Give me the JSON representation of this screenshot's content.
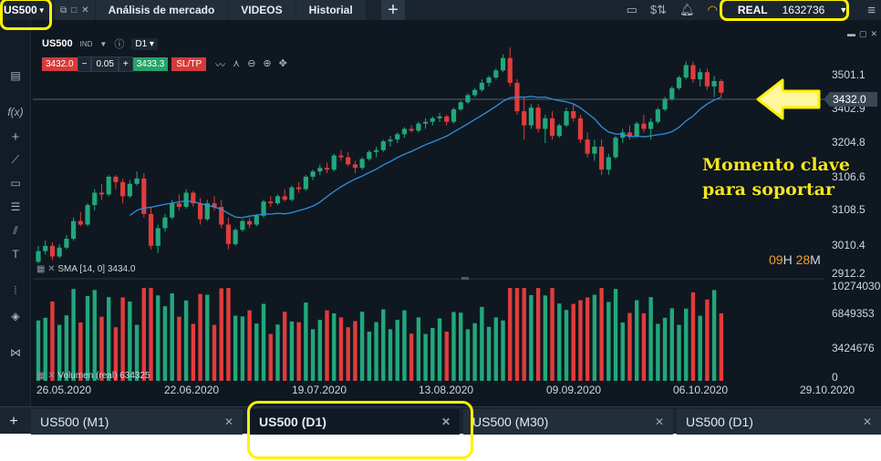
{
  "topbar": {
    "symbol": "US500",
    "tabs": [
      "Análisis de mercado",
      "VIDEOS",
      "Historial"
    ],
    "plus": "+",
    "account_type": "REAL",
    "balance": "1632736"
  },
  "chart": {
    "symbol": "US500",
    "symbol_tag": "IND",
    "timeframe": "D1",
    "sell_price": "3432.0",
    "spread": "0.05",
    "buy_price": "3433.3",
    "sltp_label": "SL/TP",
    "current_price_label": "3432.0",
    "countdown_h": "09",
    "countdown_m": "28",
    "sma_label": "SMA [14, 0] 3434.0",
    "volume_label": "Volumen (real) 634325"
  },
  "chart_data": {
    "type": "candlestick",
    "price_axis_ticks": [
      "3501.1",
      "3402.9",
      "3204.8",
      "3106.6",
      "3108.5",
      "3010.4",
      "2912.2"
    ],
    "volume_axis_ticks": [
      "10274030",
      "6849353",
      "3424676",
      "0"
    ],
    "date_ticks": [
      "26.05.2020",
      "22.06.2020",
      "19.07.2020",
      "13.08.2020",
      "09.09.2020",
      "06.10.2020",
      "29.10.2020"
    ],
    "ohlc": [
      [
        2955,
        3000,
        2950,
        2985
      ],
      [
        2985,
        3015,
        2975,
        3000
      ],
      [
        3000,
        3010,
        2960,
        2970
      ],
      [
        2970,
        3005,
        2965,
        2995
      ],
      [
        2995,
        3030,
        2990,
        3020
      ],
      [
        3020,
        3080,
        3015,
        3070
      ],
      [
        3070,
        3095,
        3055,
        3060
      ],
      [
        3060,
        3120,
        3055,
        3115
      ],
      [
        3115,
        3160,
        3100,
        3150
      ],
      [
        3150,
        3175,
        3130,
        3145
      ],
      [
        3145,
        3200,
        3140,
        3195
      ],
      [
        3195,
        3200,
        3160,
        3180
      ],
      [
        3180,
        3190,
        3120,
        3140
      ],
      [
        3140,
        3185,
        3135,
        3175
      ],
      [
        3175,
        3210,
        3170,
        3190
      ],
      [
        3190,
        3205,
        3080,
        3090
      ],
      [
        3090,
        3110,
        2990,
        3000
      ],
      [
        3000,
        3060,
        2980,
        3050
      ],
      [
        3050,
        3090,
        3040,
        3080
      ],
      [
        3080,
        3130,
        3075,
        3120
      ],
      [
        3120,
        3145,
        3100,
        3110
      ],
      [
        3110,
        3160,
        3105,
        3150
      ],
      [
        3150,
        3155,
        3110,
        3120
      ],
      [
        3120,
        3135,
        3060,
        3075
      ],
      [
        3075,
        3130,
        3070,
        3120
      ],
      [
        3120,
        3140,
        3100,
        3110
      ],
      [
        3110,
        3130,
        3050,
        3060
      ],
      [
        3060,
        3080,
        2990,
        3005
      ],
      [
        3005,
        3050,
        3000,
        3045
      ],
      [
        3045,
        3075,
        3040,
        3070
      ],
      [
        3070,
        3080,
        3050,
        3060
      ],
      [
        3060,
        3090,
        3055,
        3085
      ],
      [
        3085,
        3130,
        3080,
        3125
      ],
      [
        3125,
        3140,
        3110,
        3120
      ],
      [
        3120,
        3145,
        3115,
        3140
      ],
      [
        3140,
        3160,
        3125,
        3130
      ],
      [
        3130,
        3170,
        3125,
        3165
      ],
      [
        3165,
        3180,
        3150,
        3160
      ],
      [
        3160,
        3200,
        3155,
        3195
      ],
      [
        3195,
        3215,
        3185,
        3210
      ],
      [
        3210,
        3230,
        3200,
        3220
      ],
      [
        3220,
        3235,
        3205,
        3215
      ],
      [
        3215,
        3260,
        3210,
        3255
      ],
      [
        3255,
        3270,
        3240,
        3250
      ],
      [
        3250,
        3265,
        3225,
        3230
      ],
      [
        3230,
        3240,
        3205,
        3220
      ],
      [
        3220,
        3250,
        3215,
        3245
      ],
      [
        3245,
        3270,
        3240,
        3265
      ],
      [
        3265,
        3280,
        3250,
        3270
      ],
      [
        3270,
        3300,
        3265,
        3295
      ],
      [
        3295,
        3310,
        3280,
        3300
      ],
      [
        3300,
        3320,
        3290,
        3315
      ],
      [
        3315,
        3335,
        3305,
        3330
      ],
      [
        3330,
        3340,
        3320,
        3325
      ],
      [
        3325,
        3350,
        3320,
        3345
      ],
      [
        3345,
        3360,
        3330,
        3350
      ],
      [
        3350,
        3365,
        3340,
        3360
      ],
      [
        3360,
        3375,
        3350,
        3365
      ],
      [
        3365,
        3370,
        3340,
        3350
      ],
      [
        3350,
        3390,
        3345,
        3385
      ],
      [
        3385,
        3410,
        3380,
        3405
      ],
      [
        3405,
        3430,
        3400,
        3425
      ],
      [
        3425,
        3445,
        3420,
        3440
      ],
      [
        3440,
        3470,
        3435,
        3460
      ],
      [
        3460,
        3480,
        3450,
        3475
      ],
      [
        3475,
        3500,
        3470,
        3495
      ],
      [
        3495,
        3540,
        3490,
        3530
      ],
      [
        3530,
        3560,
        3450,
        3460
      ],
      [
        3460,
        3470,
        3370,
        3380
      ],
      [
        3380,
        3420,
        3300,
        3340
      ],
      [
        3340,
        3400,
        3330,
        3390
      ],
      [
        3390,
        3400,
        3320,
        3330
      ],
      [
        3330,
        3370,
        3290,
        3360
      ],
      [
        3360,
        3380,
        3300,
        3310
      ],
      [
        3310,
        3345,
        3305,
        3340
      ],
      [
        3340,
        3390,
        3335,
        3380
      ],
      [
        3380,
        3400,
        3350,
        3360
      ],
      [
        3360,
        3370,
        3290,
        3300
      ],
      [
        3300,
        3320,
        3250,
        3260
      ],
      [
        3260,
        3300,
        3240,
        3280
      ],
      [
        3280,
        3300,
        3200,
        3215
      ],
      [
        3215,
        3260,
        3200,
        3250
      ],
      [
        3250,
        3310,
        3245,
        3305
      ],
      [
        3305,
        3330,
        3290,
        3320
      ],
      [
        3320,
        3340,
        3300,
        3310
      ],
      [
        3310,
        3350,
        3305,
        3345
      ],
      [
        3345,
        3370,
        3320,
        3330
      ],
      [
        3330,
        3360,
        3300,
        3350
      ],
      [
        3350,
        3390,
        3345,
        3385
      ],
      [
        3385,
        3420,
        3380,
        3415
      ],
      [
        3415,
        3450,
        3410,
        3445
      ],
      [
        3445,
        3480,
        3440,
        3475
      ],
      [
        3475,
        3520,
        3470,
        3510
      ],
      [
        3510,
        3520,
        3460,
        3470
      ],
      [
        3470,
        3500,
        3450,
        3490
      ],
      [
        3490,
        3500,
        3440,
        3450
      ],
      [
        3450,
        3480,
        3420,
        3465
      ],
      [
        3465,
        3470,
        3420,
        3432
      ]
    ],
    "sma_period": 14,
    "volume_scale_max": 10274030
  },
  "colors": {
    "up": "#22a77a",
    "down": "#e03c3c",
    "sma": "#2f8fe0",
    "highlight": "#fff200"
  },
  "annotation": {
    "line1": "Momento clave",
    "line2": "para soportar"
  },
  "bottom_tabs": [
    {
      "label": "US500 (M1)"
    },
    {
      "label": "US500 (D1)"
    },
    {
      "label": "US500 (M30)"
    },
    {
      "label": "US500 (D1)"
    }
  ],
  "icons": {
    "top_right": [
      "layout-icon",
      "dollar-icon",
      "bell-icon",
      "wifi-icon",
      "menu-icon"
    ],
    "left_toolbar": [
      "chart-type-icon",
      "function-icon",
      "crosshair-icon",
      "line-icon",
      "rectangle-icon",
      "fibonacci-icon",
      "trend-icon",
      "text-icon",
      "indicators-icon",
      "layers-icon",
      "share-icon"
    ]
  }
}
